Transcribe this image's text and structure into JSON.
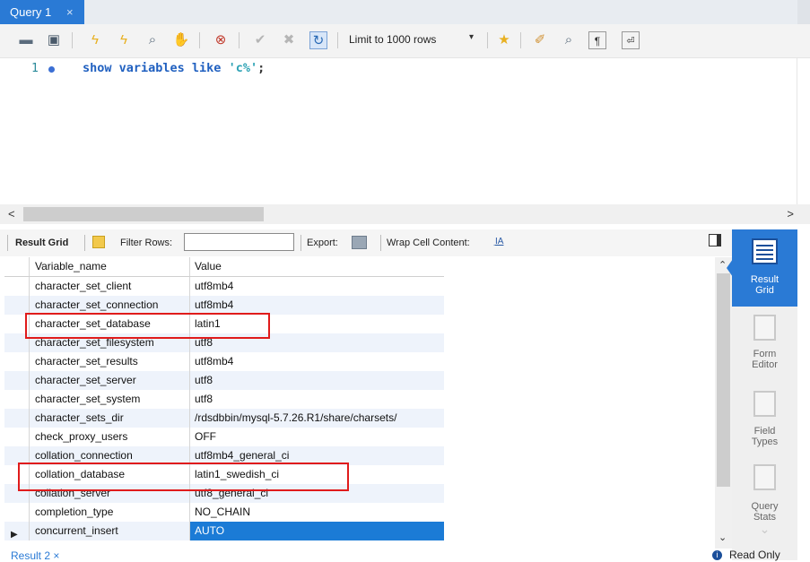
{
  "tab": {
    "title": "Query 1",
    "close": "×"
  },
  "toolbar": {
    "limit_label": "Limit to 1000 rows",
    "limit_arrow": "▾"
  },
  "editor": {
    "line_number": "1",
    "code_keyword": "show variables like ",
    "code_string": "'c%'",
    "code_end": ";"
  },
  "scroll": {
    "left": "<",
    "right": ">"
  },
  "result_toolbar": {
    "result_grid": "Result Grid",
    "filter_rows": "Filter Rows:",
    "filter_value": "",
    "export": "Export:",
    "wrap": "Wrap Cell Content:",
    "wrap_icon": "I̲A"
  },
  "grid": {
    "columns": [
      "Variable_name",
      "Value"
    ],
    "rows": [
      [
        "character_set_client",
        "utf8mb4"
      ],
      [
        "character_set_connection",
        "utf8mb4"
      ],
      [
        "character_set_database",
        "latin1"
      ],
      [
        "character_set_filesystem",
        "utf8"
      ],
      [
        "character_set_results",
        "utf8mb4"
      ],
      [
        "character_set_server",
        "utf8"
      ],
      [
        "character_set_system",
        "utf8"
      ],
      [
        "character_sets_dir",
        "/rdsdbbin/mysql-5.7.26.R1/share/charsets/"
      ],
      [
        "check_proxy_users",
        "OFF"
      ],
      [
        "collation_connection",
        "utf8mb4_general_ci"
      ],
      [
        "collation_database",
        "latin1_swedish_ci"
      ],
      [
        "collation_server",
        "utf8_general_ci"
      ],
      [
        "completion_type",
        "NO_CHAIN"
      ],
      [
        "concurrent_insert",
        "AUTO"
      ]
    ],
    "selected_row_marker": "▶"
  },
  "side_panel": {
    "result_grid": [
      "Result",
      "Grid"
    ],
    "form_editor": [
      "Form",
      "Editor"
    ],
    "field_types": [
      "Field",
      "Types"
    ],
    "query_stats": [
      "Query",
      "Stats"
    ]
  },
  "bottom": {
    "result_tab": "Result 2 ×",
    "read_only": "Read Only",
    "info": "i"
  },
  "colors": {
    "accent": "#2a7ad5",
    "selected": "#1b7bd6",
    "highlight": "#e01b1b"
  }
}
